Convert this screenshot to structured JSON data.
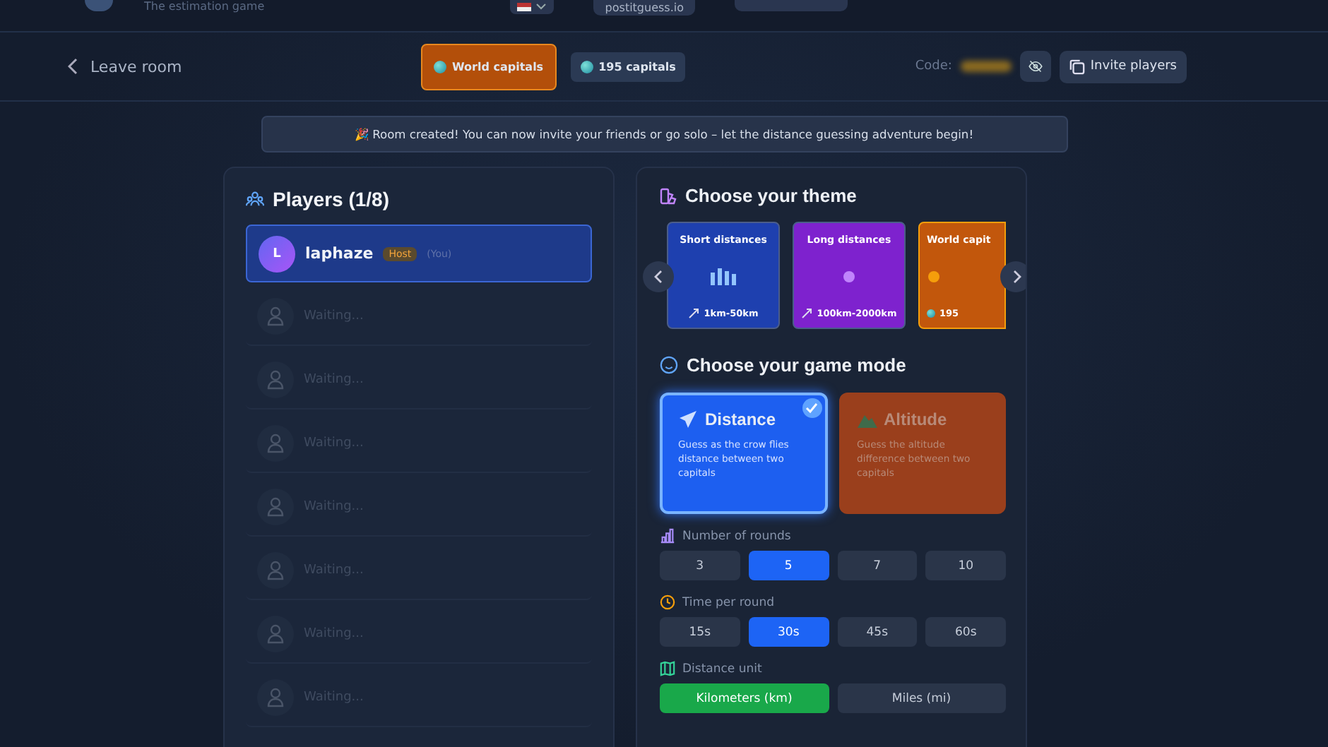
{
  "header": {
    "tagline": "The estimation game",
    "site_link": "postitguess.io"
  },
  "room_bar": {
    "leave_label": "Leave room",
    "theme_chip": "World capitals",
    "count_chip": "195 capitals",
    "code_label": "Code:",
    "code_hidden": true,
    "invite_label": "Invite players"
  },
  "banner": "🎉 Room created! You can now invite your friends or go solo – let the distance guessing adventure begin!",
  "players": {
    "title": "Players (1/8)",
    "list": [
      {
        "kind": "player",
        "initial": "L",
        "name": "laphaze",
        "badge": "Host",
        "note": "(You)"
      },
      {
        "kind": "empty",
        "label": "Waiting..."
      },
      {
        "kind": "empty",
        "label": "Waiting..."
      },
      {
        "kind": "empty",
        "label": "Waiting..."
      },
      {
        "kind": "empty",
        "label": "Waiting..."
      },
      {
        "kind": "empty",
        "label": "Waiting..."
      },
      {
        "kind": "empty",
        "label": "Waiting..."
      },
      {
        "kind": "empty",
        "label": "Waiting..."
      }
    ]
  },
  "themes": {
    "title": "Choose your theme",
    "items": [
      {
        "kind": "bars",
        "title": "Short distances",
        "detail": "1km-50km",
        "color": "#1e40af",
        "selected": false
      },
      {
        "kind": "dot",
        "title": "Long distances",
        "detail": "100km-2000km",
        "color": "#7e22ce",
        "selected": false
      },
      {
        "kind": "globe",
        "title": "World capit",
        "detail": "195",
        "color": "#c2570c",
        "selected": true
      }
    ]
  },
  "modes": {
    "title": "Choose your game mode",
    "items": [
      {
        "kind": "plane",
        "title": "Distance",
        "description": "Guess as the crow flies distance between two capitals",
        "color": "#1d5ff0",
        "selected": true
      },
      {
        "kind": "mountain",
        "title": "Altitude",
        "description": "Guess the altitude difference between two capitals",
        "color": "#9a3f1c",
        "selected": false
      }
    ]
  },
  "settings": [
    {
      "kind": "rounds",
      "label": "Number of rounds",
      "options": [
        {
          "label": "3",
          "selected": false
        },
        {
          "label": "5",
          "selected": true
        },
        {
          "label": "7",
          "selected": false
        },
        {
          "label": "10",
          "selected": false
        }
      ]
    },
    {
      "kind": "time",
      "label": "Time per round",
      "options": [
        {
          "label": "15s",
          "selected": false
        },
        {
          "label": "30s",
          "selected": true
        },
        {
          "label": "45s",
          "selected": false
        },
        {
          "label": "60s",
          "selected": false
        }
      ]
    },
    {
      "kind": "unit",
      "label": "Distance unit",
      "options": [
        {
          "label": "Kilometers (km)",
          "selected": true
        },
        {
          "label": "Miles (mi)",
          "selected": false
        }
      ]
    }
  ]
}
